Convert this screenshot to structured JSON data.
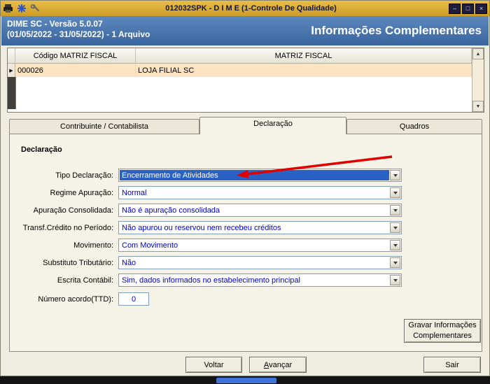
{
  "titlebar": {
    "title": "012032SPK - D I M E (1-Controle De Qualidade)"
  },
  "icons": {
    "minimize": "–",
    "maximize": "□",
    "close": "×",
    "scroll_up": "▲",
    "scroll_down": "▼",
    "row_marker": "▶"
  },
  "header": {
    "version_line": "DIME SC - Versão 5.0.07",
    "period_line": "(01/05/2022 - 31/05/2022) - 1 Arquivo",
    "section_title": "Informações Complementares"
  },
  "grid": {
    "columns": [
      "Código MATRIZ FISCAL",
      "MATRIZ FISCAL"
    ],
    "rows": [
      {
        "codigo": "000026",
        "matriz": "LOJA FILIAL SC"
      }
    ]
  },
  "tabs": [
    {
      "label": "Contribuinte / Contabilista"
    },
    {
      "label": "Declaração"
    },
    {
      "label": "Quadros"
    }
  ],
  "form": {
    "group_title": "Declaração",
    "fields": [
      {
        "label": "Tipo Declaração:",
        "value": "Encerramento de Atividades"
      },
      {
        "label": "Regime Apuração:",
        "value": "Normal"
      },
      {
        "label": "Apuração Consolidada:",
        "value": "Não é apuração consolidada"
      },
      {
        "label": "Transf.Crédito no Período:",
        "value": "Não apurou ou reservou nem recebeu créditos"
      },
      {
        "label": "Movimento:",
        "value": "Com Movimento"
      },
      {
        "label": "Substituto Tributário:",
        "value": "Não"
      },
      {
        "label": "Escrita Contábil:",
        "value": "Sim, dados informados no estabelecimento principal"
      }
    ],
    "ttd": {
      "label": "Número acordo(TTD):",
      "value": "0"
    }
  },
  "buttons": {
    "gravar": "Gravar Informações Complementares",
    "voltar": "Voltar",
    "avancar": "Avançar",
    "sair": "Sair"
  },
  "colors": {
    "titlebar_gold": "#D9A92F",
    "header_blue": "#41699F",
    "selection_blue": "#2A61C4",
    "row_highlight": "#FCE4C2",
    "value_text": "#0000CC",
    "annotation_red": "#E00000"
  }
}
